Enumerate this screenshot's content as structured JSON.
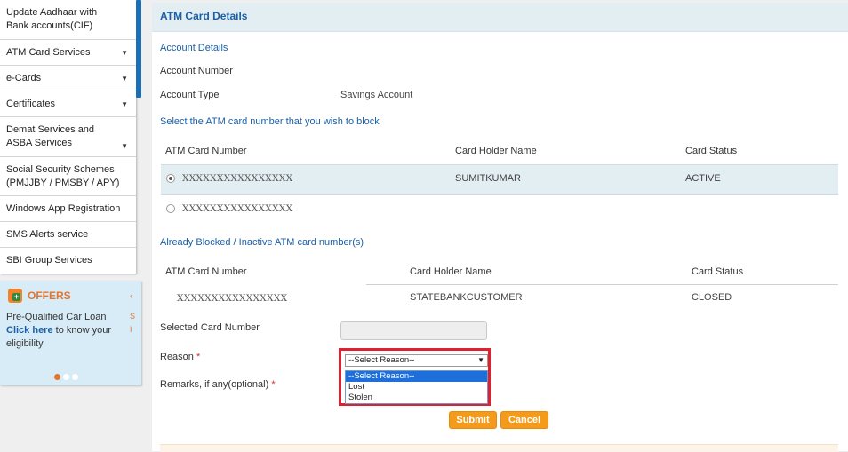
{
  "sidebar": {
    "items": [
      {
        "label": "Update Aadhaar with Bank accounts(CIF)",
        "caret": ""
      },
      {
        "label": "ATM Card Services",
        "caret": "▼"
      },
      {
        "label": "e-Cards",
        "caret": "▼"
      },
      {
        "label": "Certificates",
        "caret": "▼"
      },
      {
        "label": "Demat Services and ASBA Services",
        "caret": "▼"
      },
      {
        "label": "Social Security Schemes (PMJJBY / PMSBY / APY)",
        "caret": ""
      },
      {
        "label": "Windows App Registration",
        "caret": ""
      },
      {
        "label": "SMS Alerts service",
        "caret": ""
      },
      {
        "label": "SBI Group Services",
        "caret": ""
      }
    ],
    "offers": {
      "title": "OFFERS",
      "line1": "Pre-Qualified Car Loan",
      "link": "Click here",
      "line2_rest": " to know your",
      "line3": "eligibility",
      "side1": "‹",
      "side2": "S",
      "side3": "I"
    }
  },
  "main": {
    "title": "ATM Card Details",
    "account_details_heading": "Account Details",
    "account_number_label": "Account Number",
    "account_type_label": "Account Type",
    "account_type_value": "Savings Account",
    "select_heading": "Select the ATM card number that you wish to block",
    "active_table": {
      "headers": [
        "ATM Card Number",
        "Card Holder Name",
        "Card Status"
      ],
      "rows": [
        {
          "card": "XXXXXXXXXXXXXXXX",
          "holder": "SUMITKUMAR",
          "status": "ACTIVE",
          "selected": true
        },
        {
          "card": "XXXXXXXXXXXXXXXX",
          "holder": "",
          "status": "",
          "selected": false
        }
      ]
    },
    "blocked_heading": "Already Blocked / Inactive ATM card number(s)",
    "blocked_table": {
      "headers": [
        "ATM Card Number",
        "Card Holder Name",
        "Card Status"
      ],
      "rows": [
        {
          "card": "XXXXXXXXXXXXXXXX",
          "holder": "STATEBANKCUSTOMER",
          "status": "CLOSED"
        }
      ]
    },
    "selected_card_label": "Selected Card Number",
    "selected_card_value": "",
    "reason_label": "Reason",
    "remarks_label": "Remarks, if any(optional)",
    "required_mark": "*",
    "reason_select": {
      "value": "--Select Reason--",
      "options": [
        "--Select Reason--",
        "Lost",
        "Stolen"
      ]
    },
    "submit_label": "Submit",
    "cancel_label": "Cancel"
  },
  "colors": {
    "accent_blue": "#1a5fa8",
    "button_orange": "#f59b1c",
    "highlight_red": "#e0202f",
    "row_highlight": "#e3eef2"
  }
}
